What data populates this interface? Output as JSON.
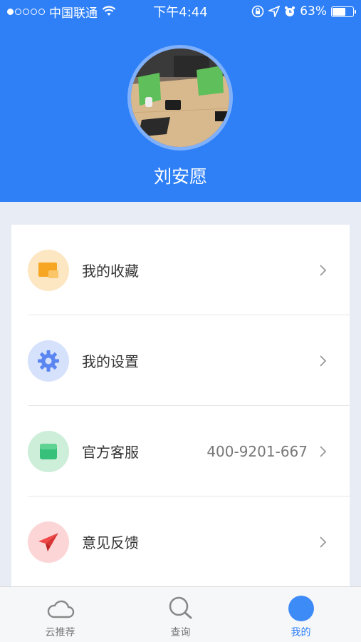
{
  "status_bar": {
    "carrier": "中国联通",
    "time": "下午4:44",
    "battery": "63%",
    "battery_level": 0.63,
    "signal_dots_filled": 1,
    "signal_dots_total": 5
  },
  "profile": {
    "name": "刘安愿"
  },
  "menu": [
    {
      "label": "我的收藏",
      "value": "",
      "icon": "folder-icon",
      "color": "#f7a623"
    },
    {
      "label": "我的设置",
      "value": "",
      "icon": "gear-icon",
      "color": "#5b86f2"
    },
    {
      "label": "官方客服",
      "value": "400-9201-667",
      "icon": "service-icon",
      "color": "#37c07a"
    },
    {
      "label": "意见反馈",
      "value": "",
      "icon": "paper-plane-icon",
      "color": "#f04848"
    }
  ],
  "tabbar": {
    "tabs": [
      {
        "label": "云推荐",
        "icon": "cloud-icon",
        "active": false
      },
      {
        "label": "查询",
        "icon": "search-icon",
        "active": false
      },
      {
        "label": "我的",
        "icon": "profile-icon",
        "active": true
      }
    ]
  },
  "colors": {
    "primary": "#2f80f7",
    "background": "#e8edf5"
  }
}
